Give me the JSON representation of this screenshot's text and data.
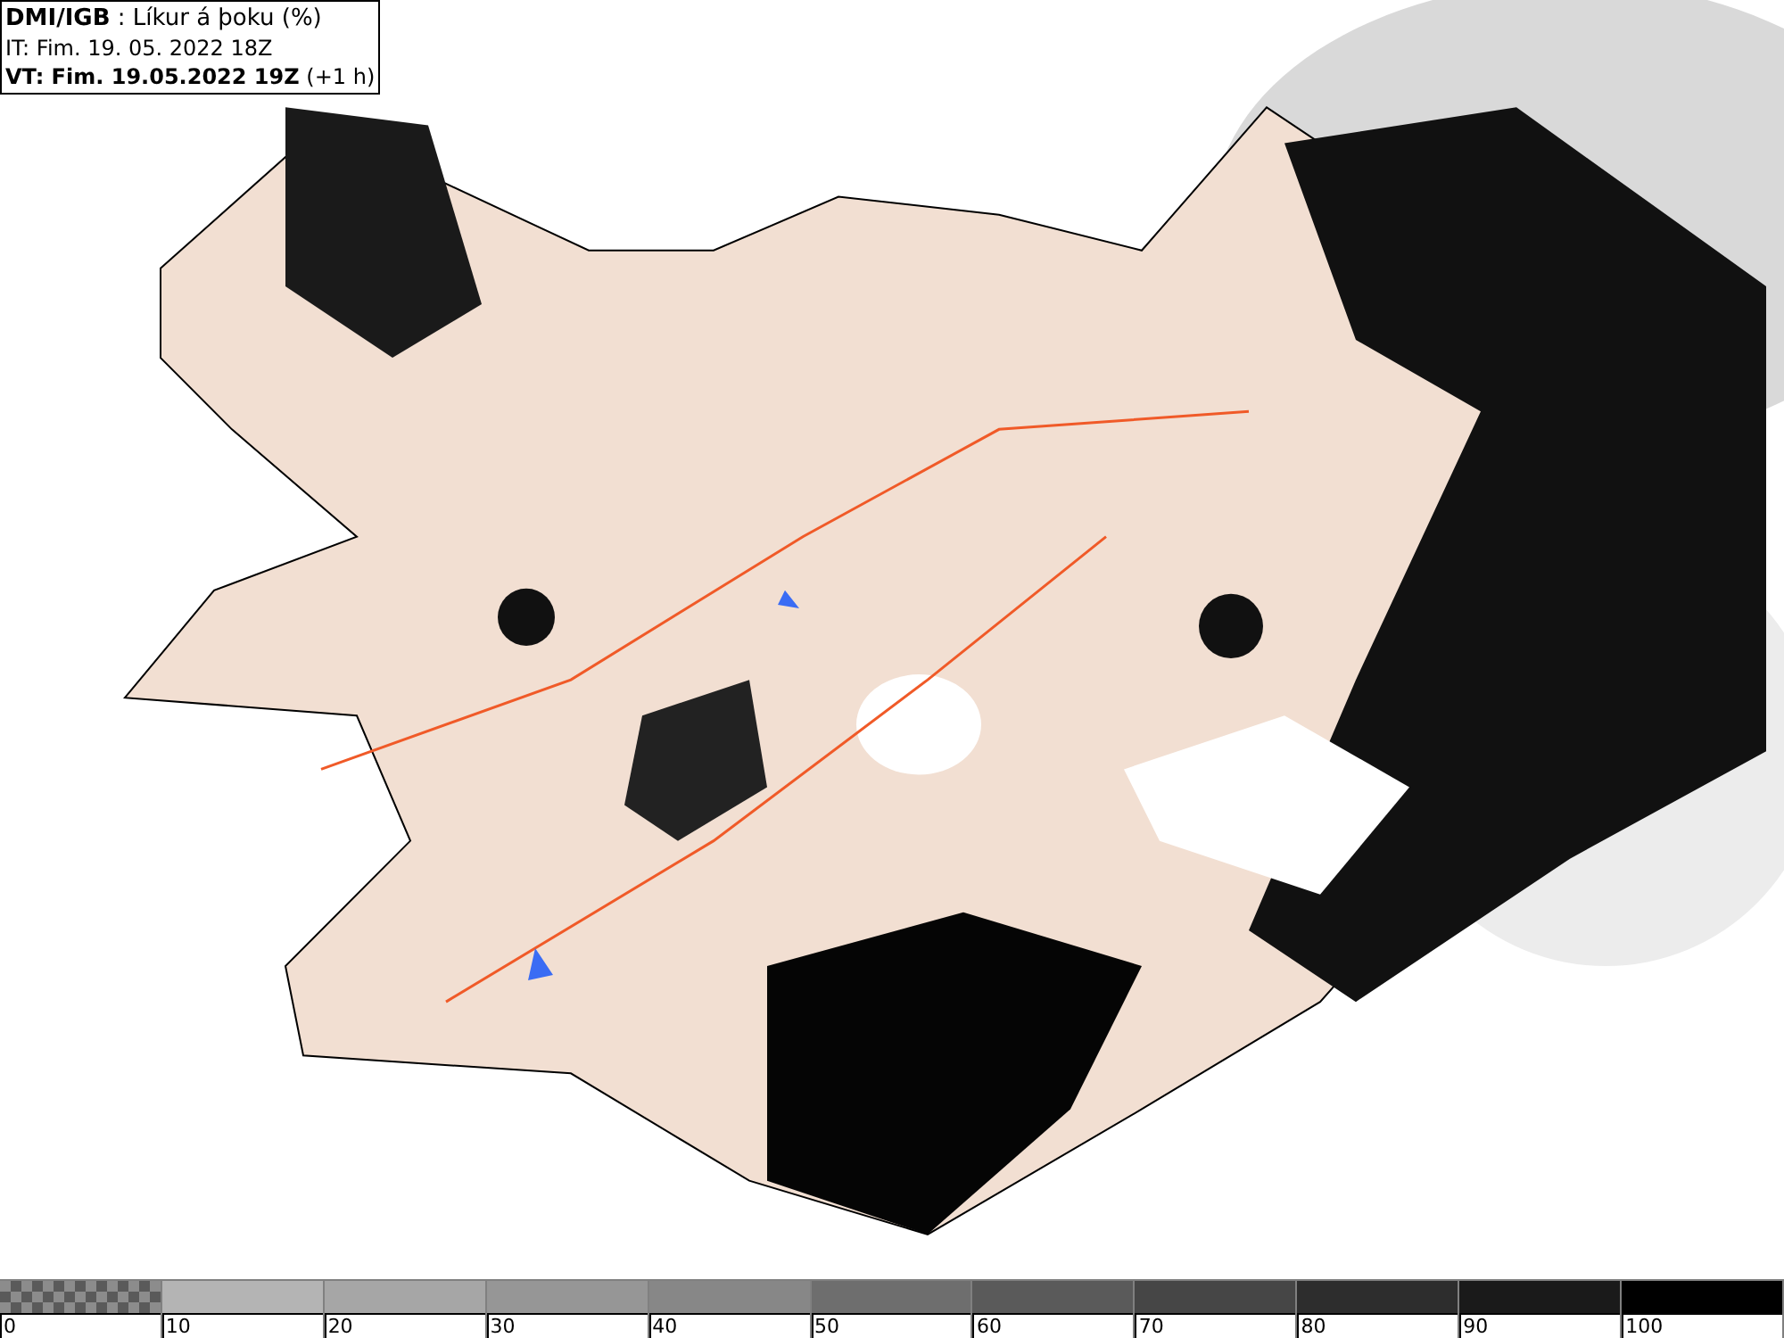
{
  "header": {
    "lines": [
      "**DMI/IGB** : Líkur á þoku (%)",
      "IT: Fim. 19. 05. 2022 18Z",
      "**VT: Fim. 19.05.2022 19Z** (+1 h)"
    ]
  },
  "legend": [
    {
      "label": "0",
      "kind": "checker",
      "color": "#8c8c8c"
    },
    {
      "label": "10",
      "kind": "solid",
      "color": "#b4b4b4"
    },
    {
      "label": "20",
      "kind": "solid",
      "color": "#a6a6a6"
    },
    {
      "label": "30",
      "kind": "solid",
      "color": "#969696"
    },
    {
      "label": "40",
      "kind": "solid",
      "color": "#878787"
    },
    {
      "label": "50",
      "kind": "solid",
      "color": "#6e6e6e"
    },
    {
      "label": "60",
      "kind": "solid",
      "color": "#5a5a5a"
    },
    {
      "label": "70",
      "kind": "solid",
      "color": "#464646"
    },
    {
      "label": "80",
      "kind": "solid",
      "color": "#2d2d2d"
    },
    {
      "label": "90",
      "kind": "solid",
      "color": "#1a1a1a"
    },
    {
      "label": "100",
      "kind": "solid",
      "color": "#000000"
    }
  ]
}
